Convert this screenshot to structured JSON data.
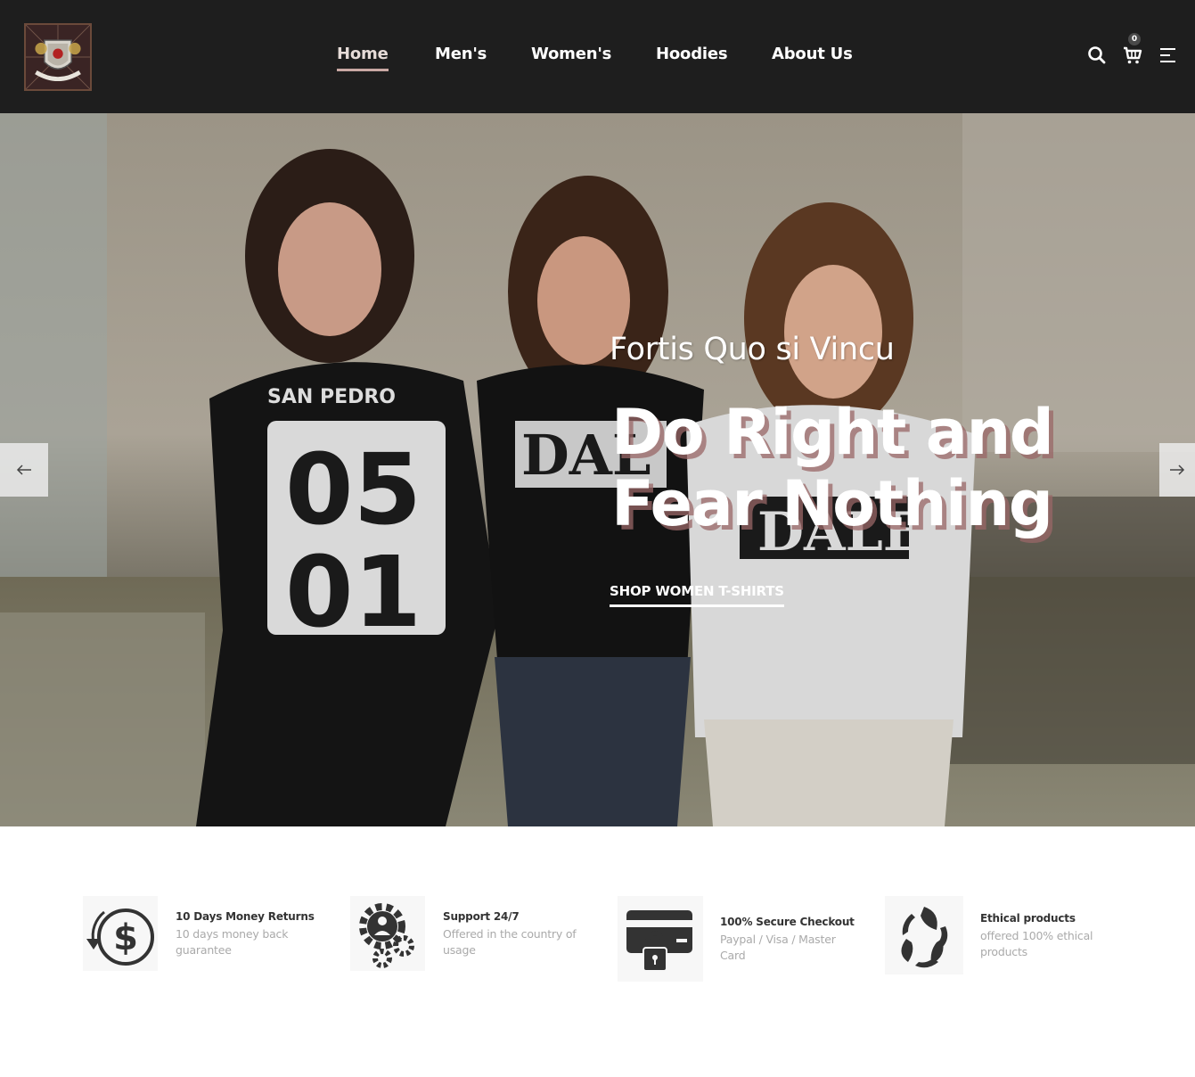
{
  "header": {
    "nav": [
      "Home",
      "Men's",
      "Women's",
      "Hoodies",
      "About Us"
    ],
    "active_nav": "Home",
    "cart_count": "0",
    "icons": [
      "search-icon",
      "cart-icon",
      "menu-icon"
    ]
  },
  "hero": {
    "subtitle": "Fortis Quo si Vincu",
    "title_line1": "Do Right and",
    "title_line2": "Fear Nothing",
    "cta": "SHOP WOMEN T-SHIRTS",
    "prev_icon": "arrow-left-icon",
    "next_icon": "arrow-right-icon"
  },
  "features": [
    {
      "icon": "money-return-icon",
      "title": "10 Days Money Returns",
      "desc_1": "10 days money back",
      "desc_2": "guarantee"
    },
    {
      "icon": "support-gears-icon",
      "title": "Support 24/7",
      "desc_1": "Offered in the country of",
      "desc_2": "usage"
    },
    {
      "icon": "secure-card-icon",
      "title": "100% Secure Checkout",
      "desc_1": "Paypal / Visa / Master",
      "desc_2": "Card"
    },
    {
      "icon": "ethical-leaves-icon",
      "title": "Ethical products",
      "desc_1": "offered 100% ethical",
      "desc_2": "products"
    }
  ],
  "colors": {
    "header_bg": "#1e1e1e",
    "active_underline": "#c9a8a3",
    "title_shadow": "#996767"
  }
}
